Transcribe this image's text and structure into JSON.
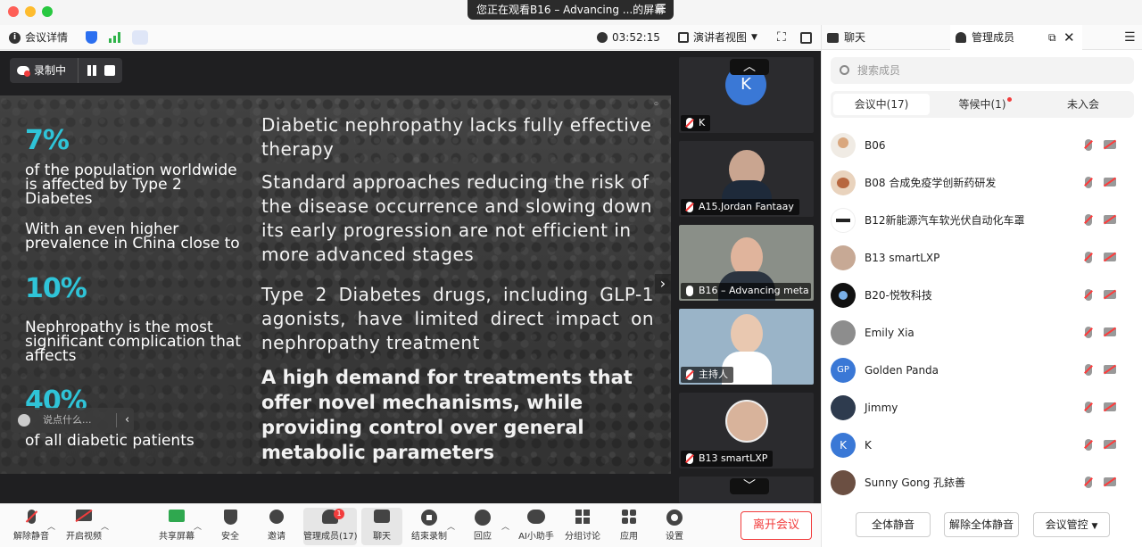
{
  "window": {
    "share_banner": "您正在观看B16 – Advancing ...的屏幕"
  },
  "meeting_bar": {
    "details_label": "会议详情",
    "timer": "03:52:15",
    "view_label": "演讲者视图"
  },
  "recording": {
    "label": "录制中"
  },
  "slide": {
    "stat1": "7%",
    "text1": "of the population worldwide is affected by Type 2 Diabetes",
    "text2": "With an even higher prevalence in China close to",
    "stat2": "10%",
    "text3": "Nephropathy is the most significant complication that affects",
    "stat3": "40%",
    "text4": "of all diabetic patients",
    "bullet1": "Diabetic nephropathy lacks fully effective therapy",
    "bullet2": "Standard approaches reducing the risk of the disease occurrence and slowing down its early progression are not efficient in more advanced stages",
    "bullet3": "Type 2 Diabetes drugs, including GLP-1 agonists, have limited direct impact on nephropathy treatment",
    "bullet4": "A high demand for treatments that offer novel mechanisms, while providing control over general metabolic parameters"
  },
  "chat_input": {
    "placeholder": "说点什么..."
  },
  "video_tiles": [
    {
      "name": "K",
      "initial": "K"
    },
    {
      "name": "A15.Jordan Fantaay"
    },
    {
      "name": "B16 – Advancing meta"
    },
    {
      "name": "主持人"
    },
    {
      "name": "B13 smartLXP"
    }
  ],
  "toolbar": {
    "mute": "解除静音",
    "video": "开启视频",
    "share": "共享屏幕",
    "security": "安全",
    "invite": "邀请",
    "members": "管理成员(17)",
    "members_badge": "1",
    "chat": "聊天",
    "end_rec": "结束录制",
    "reactions": "回应",
    "ai": "AI小助手",
    "breakout": "分组讨论",
    "apps": "应用",
    "settings": "设置",
    "leave": "离开会议"
  },
  "panel": {
    "tab_chat": "聊天",
    "tab_members": "管理成员",
    "search_placeholder": "搜索成员",
    "seg_in_meeting": "会议中(17)",
    "seg_waiting": "等候中(1)",
    "seg_absent": "未入会",
    "members": [
      {
        "name": "B06"
      },
      {
        "name": "B08 合成免疫学创新药研发"
      },
      {
        "name": "B12新能源汽车软光伏自动化车罩"
      },
      {
        "name": "B13 smartLXP"
      },
      {
        "name": "B20-悦牧科技"
      },
      {
        "name": "Emily Xia"
      },
      {
        "name": "Golden Panda",
        "initials": "GP"
      },
      {
        "name": "Jimmy"
      },
      {
        "name": "K",
        "initials": "K"
      },
      {
        "name": "Sunny Gong 孔銥善"
      }
    ],
    "mute_all": "全体静音",
    "unmute_all": "解除全体静音",
    "controls": "会议管控"
  }
}
